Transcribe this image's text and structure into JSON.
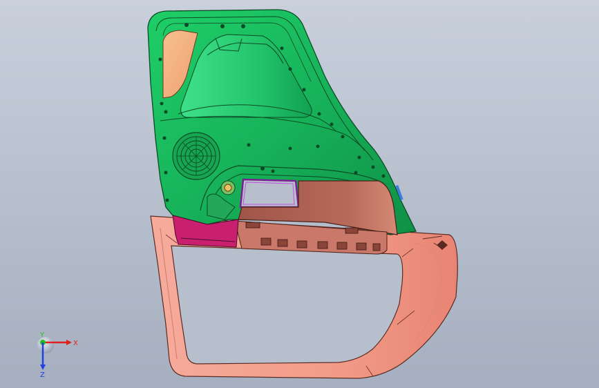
{
  "viewport": {
    "background_top": "#c9d0dc",
    "background_bottom": "#a5afbf"
  },
  "model": {
    "part": "door-trim-panel",
    "colors": {
      "green_panel": "#1bb85d",
      "green_dark": "#0e7a3a",
      "salmon_frame": "#f4a08e",
      "brown_insert": "#a85a4e",
      "magenta_insert": "#c8206e",
      "peach_window": "#f5b58a",
      "edge": "#2a2a2a"
    }
  },
  "triad": {
    "x_label": "X",
    "y_label": "Y",
    "z_label": "Z",
    "x_color": "#e02020",
    "y_color": "#20c020",
    "z_color": "#2040e0"
  }
}
